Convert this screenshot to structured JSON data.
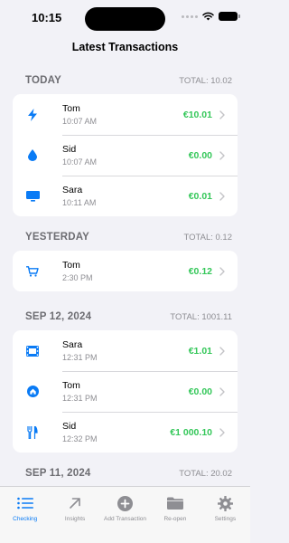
{
  "status": {
    "time": "10:15"
  },
  "title": "Latest Transactions",
  "sections": [
    {
      "title": "TODAY",
      "total": "TOTAL: 10.02",
      "rows": [
        {
          "name": "Tom",
          "time": "10:07 AM",
          "amount": "€10.01",
          "icon": "bolt-icon"
        },
        {
          "name": "Sid",
          "time": "10:07 AM",
          "amount": "€0.00",
          "icon": "drop-icon"
        },
        {
          "name": "Sara",
          "time": "10:11 AM",
          "amount": "€0.01",
          "icon": "display-icon"
        }
      ]
    },
    {
      "title": "YESTERDAY",
      "total": "TOTAL: 0.12",
      "rows": [
        {
          "name": "Tom",
          "time": "2:30 PM",
          "amount": "€0.12",
          "icon": "cart-icon"
        }
      ]
    },
    {
      "title": "SEP 12, 2024",
      "total": "TOTAL: 1001.11",
      "rows": [
        {
          "name": "Sara",
          "time": "12:31 PM",
          "amount": "€1.01",
          "icon": "film-icon"
        },
        {
          "name": "Tom",
          "time": "12:31 PM",
          "amount": "€0.00",
          "icon": "home-icon"
        },
        {
          "name": "Sid",
          "time": "12:32 PM",
          "amount": "€1 000.10",
          "icon": "fork-knife-icon"
        }
      ]
    },
    {
      "title": "SEP 11, 2024",
      "total": "TOTAL: 20.02",
      "rows": []
    }
  ],
  "tabs": [
    {
      "label": "Checking",
      "icon": "list-icon",
      "active": true
    },
    {
      "label": "Insights",
      "icon": "arrow-up-right-icon",
      "active": false
    },
    {
      "label": "Add Transaction",
      "icon": "plus-circle-icon",
      "active": false
    },
    {
      "label": "Re-open",
      "icon": "folder-icon",
      "active": false
    },
    {
      "label": "Settings",
      "icon": "gear-icon",
      "active": false
    }
  ],
  "colors": {
    "accent": "#0a7bf5",
    "positive": "#34c759",
    "background": "#f2f2f7"
  }
}
